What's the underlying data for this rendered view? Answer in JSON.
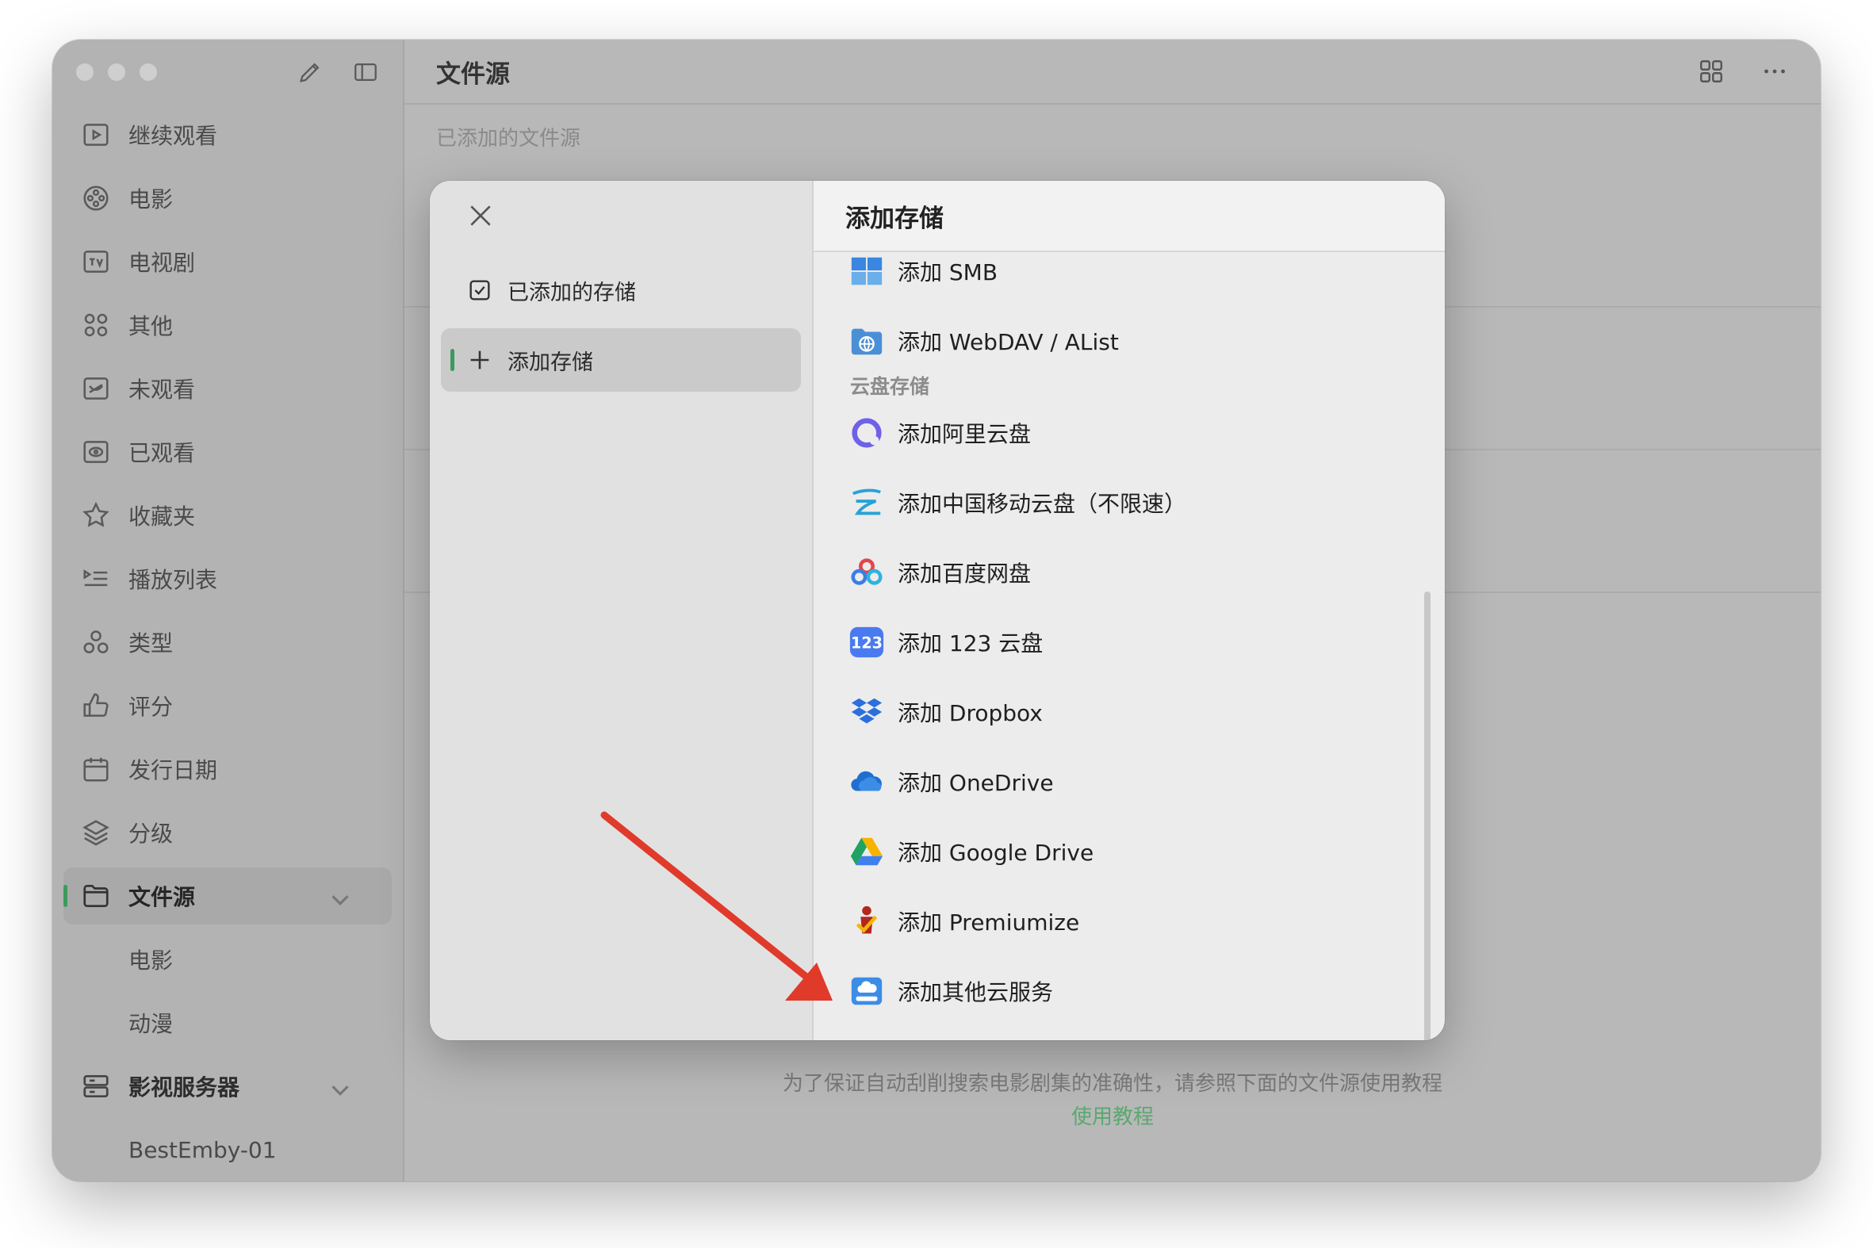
{
  "sidebar": {
    "items": [
      {
        "label": "继续观看",
        "icon": "play-square-icon"
      },
      {
        "label": "电影",
        "icon": "film-reel-icon"
      },
      {
        "label": "电视剧",
        "icon": "tv-icon"
      },
      {
        "label": "其他",
        "icon": "grid-circles-icon"
      },
      {
        "label": "未观看",
        "icon": "eye-slash-icon"
      },
      {
        "label": "已观看",
        "icon": "eye-icon"
      },
      {
        "label": "收藏夹",
        "icon": "star-icon"
      },
      {
        "label": "播放列表",
        "icon": "playlist-icon"
      },
      {
        "label": "类型",
        "icon": "shapes-icon"
      },
      {
        "label": "评分",
        "icon": "thumbs-up-icon"
      },
      {
        "label": "发行日期",
        "icon": "calendar-icon"
      },
      {
        "label": "分级",
        "icon": "layers-icon"
      }
    ],
    "file_source": {
      "label": "文件源",
      "icon": "folder-icon"
    },
    "file_source_children": [
      "电影",
      "动漫"
    ],
    "media_server": {
      "label": "影视服务器",
      "icon": "server-icon"
    },
    "media_server_children": [
      "BestEmby-01"
    ]
  },
  "main": {
    "title": "文件源",
    "added_label": "已添加的文件源",
    "hint": "为了保证自动刮削搜索电影剧集的准确性，请参照下面的文件源使用教程",
    "tutorial_link": "使用教程"
  },
  "modal": {
    "nav": {
      "added": "已添加的存储",
      "add": "添加存储"
    },
    "title": "添加存储",
    "rows": {
      "smb": "添加 SMB",
      "webdav": "添加 WebDAV / AList",
      "cloud_section": "云盘存储",
      "aliyun": "添加阿里云盘",
      "china_mobile": "添加中国移动云盘（不限速）",
      "baidu": "添加百度网盘",
      "pan123": "添加 123 云盘",
      "dropbox": "添加 Dropbox",
      "onedrive": "添加 OneDrive",
      "google_drive": "添加 Google Drive",
      "premiumize": "添加 Premiumize",
      "other_cloud": "添加其他云服务"
    }
  },
  "colors": {
    "accent_green": "#3d9a5d",
    "link_green": "#5aa86f",
    "annotation_red": "#e03a2b"
  }
}
